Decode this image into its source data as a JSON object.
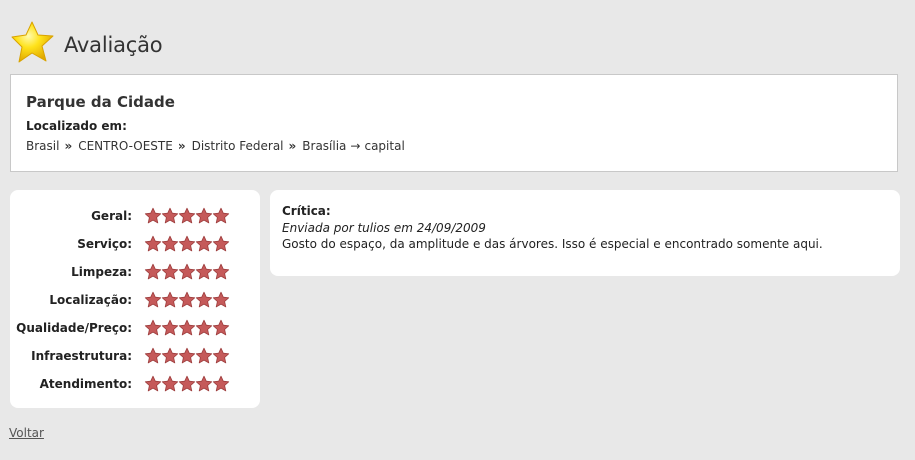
{
  "header": {
    "title": "Avaliação",
    "icon": "star-icon",
    "icon_color": "#f5d800"
  },
  "place": {
    "name": "Parque da Cidade",
    "located_label": "Localizado em:",
    "breadcrumb": [
      "Brasil",
      "CENTRO-OESTE",
      "Distrito Federal",
      "Brasília"
    ],
    "breadcrumb_separator": "»",
    "breadcrumb_arrow": "→",
    "breadcrumb_suffix": "capital"
  },
  "ratings": {
    "star_color": "#c55a5a",
    "max_stars": 5,
    "items": [
      {
        "label": "Geral:",
        "stars": 5
      },
      {
        "label": "Serviço:",
        "stars": 5
      },
      {
        "label": "Limpeza:",
        "stars": 5
      },
      {
        "label": "Localização:",
        "stars": 5
      },
      {
        "label": "Qualidade/Preço:",
        "stars": 5
      },
      {
        "label": "Infraestrutura:",
        "stars": 5
      },
      {
        "label": "Atendimento:",
        "stars": 5
      }
    ]
  },
  "review": {
    "heading": "Crítica:",
    "meta": "Enviada por tulios em 24/09/2009",
    "text": "Gosto do espaço, da amplitude e das árvores. Isso é especial e encontrado somente aqui."
  },
  "footer": {
    "back_label": "Voltar"
  }
}
